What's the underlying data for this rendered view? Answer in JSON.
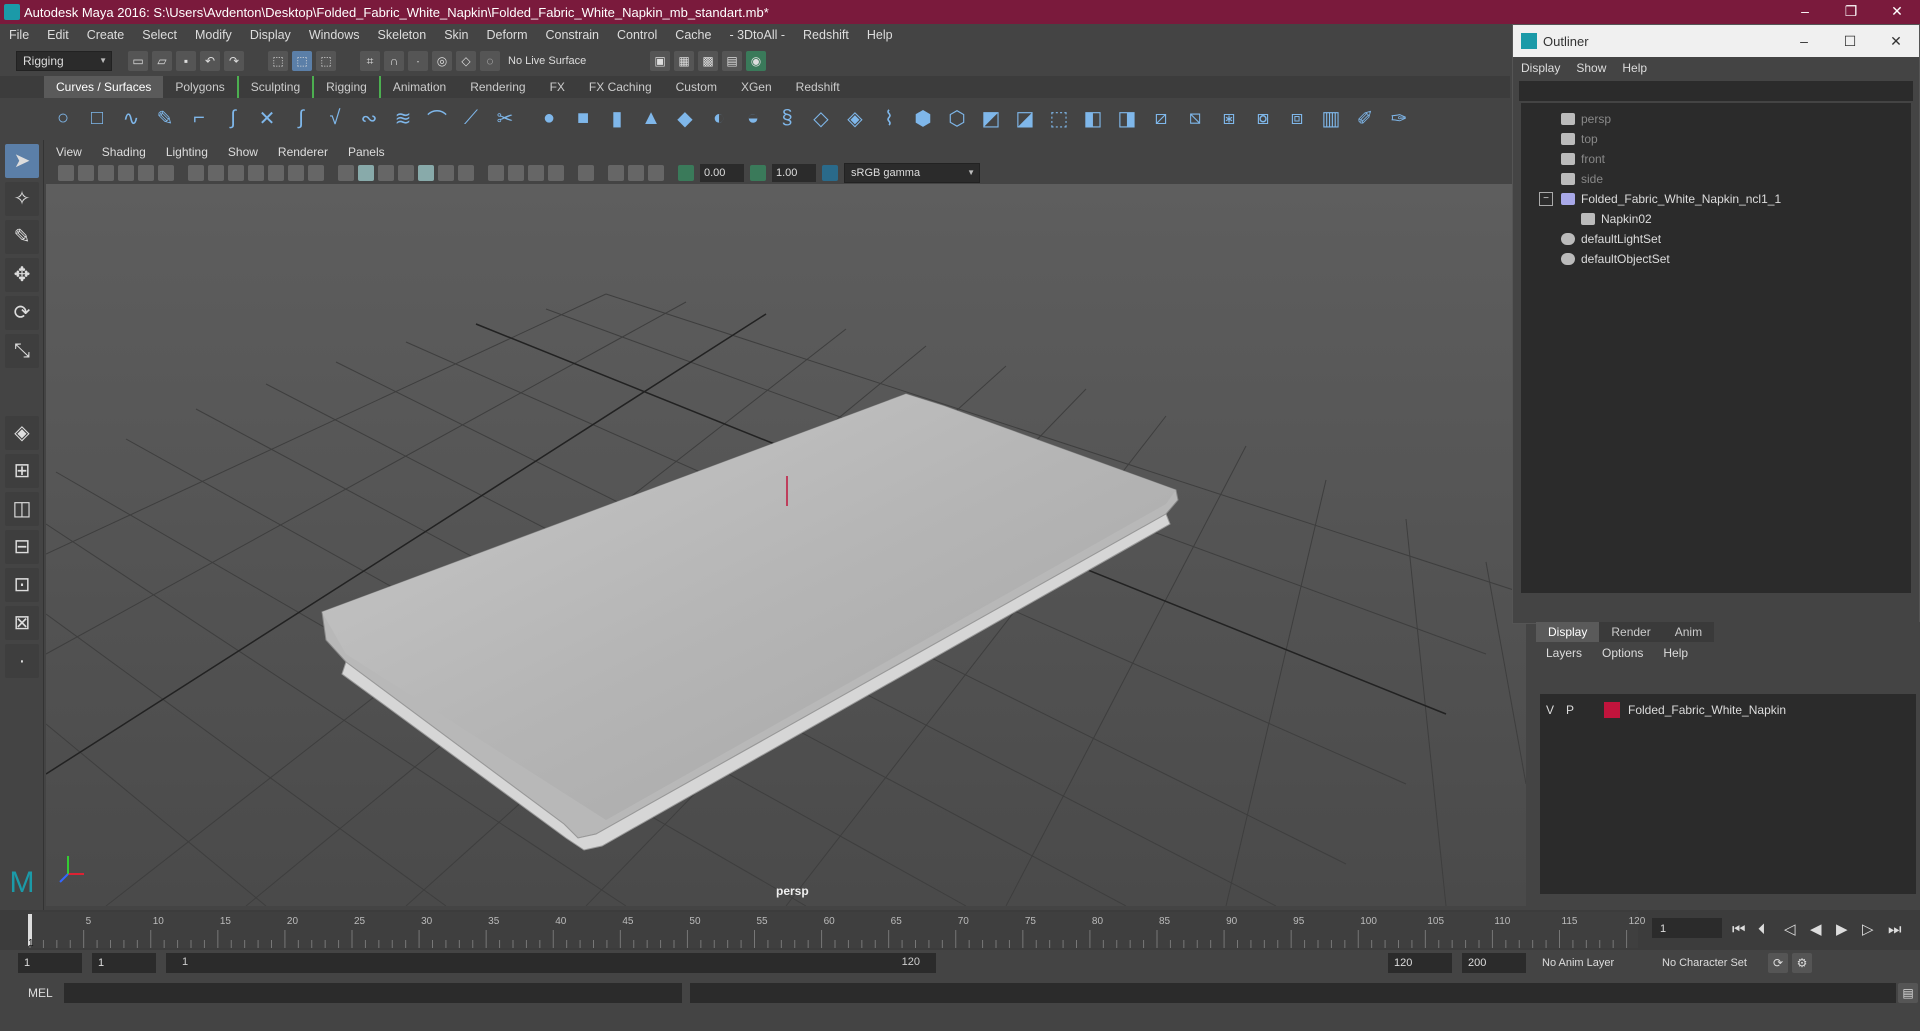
{
  "window": {
    "title": "Autodesk Maya 2016: S:\\Users\\Avdenton\\Desktop\\Folded_Fabric_White_Napkin\\Folded_Fabric_White_Napkin_mb_standart.mb*"
  },
  "menubar": [
    "File",
    "Edit",
    "Create",
    "Select",
    "Modify",
    "Display",
    "Windows",
    "Skeleton",
    "Skin",
    "Deform",
    "Constrain",
    "Control",
    "Cache",
    "- 3DtoAll -",
    "Redshift",
    "Help"
  ],
  "statusline": {
    "mode": "Rigging",
    "live_surface": "No Live Surface"
  },
  "shelf_tabs": [
    "Curves / Surfaces",
    "Polygons",
    "Sculpting",
    "Rigging",
    "Animation",
    "Rendering",
    "FX",
    "FX Caching",
    "Custom",
    "XGen",
    "Redshift"
  ],
  "panel_menu": [
    "View",
    "Shading",
    "Lighting",
    "Show",
    "Renderer",
    "Panels"
  ],
  "panel_toolbar": {
    "exposure": "0.00",
    "gamma": "1.00",
    "color_space": "sRGB gamma"
  },
  "viewport": {
    "camera_label": "persp"
  },
  "outliner": {
    "title": "Outliner",
    "menu": [
      "Display",
      "Show",
      "Help"
    ],
    "items": [
      {
        "label": "persp",
        "dim": true
      },
      {
        "label": "top",
        "dim": true
      },
      {
        "label": "front",
        "dim": true
      },
      {
        "label": "side",
        "dim": true
      },
      {
        "label": "Folded_Fabric_White_Napkin_ncl1_1",
        "dim": false
      },
      {
        "label": "Napkin02",
        "dim": false
      },
      {
        "label": "defaultLightSet",
        "dim": false
      },
      {
        "label": "defaultObjectSet",
        "dim": false
      }
    ]
  },
  "layer_editor": {
    "tabs": [
      "Display",
      "Render",
      "Anim"
    ],
    "menu": [
      "Layers",
      "Options",
      "Help"
    ],
    "layer": {
      "v": "V",
      "p": "P",
      "name": "Folded_Fabric_White_Napkin",
      "color": "#c0143c"
    }
  },
  "timeline": {
    "ticks": [
      "5",
      "10",
      "15",
      "20",
      "25",
      "30",
      "35",
      "40",
      "45",
      "50",
      "55",
      "60",
      "65",
      "70",
      "75",
      "80",
      "85",
      "90",
      "95",
      "100",
      "105",
      "110",
      "115",
      "120"
    ],
    "current_frame": "1",
    "start_marker": "1"
  },
  "range": {
    "start": "1",
    "inner_start": "1",
    "slider_start": "1",
    "slider_end": "120",
    "end": "120",
    "total_end": "200",
    "anim_layer": "No Anim Layer",
    "char_set": "No Character Set"
  },
  "command_line": {
    "label": "MEL"
  }
}
